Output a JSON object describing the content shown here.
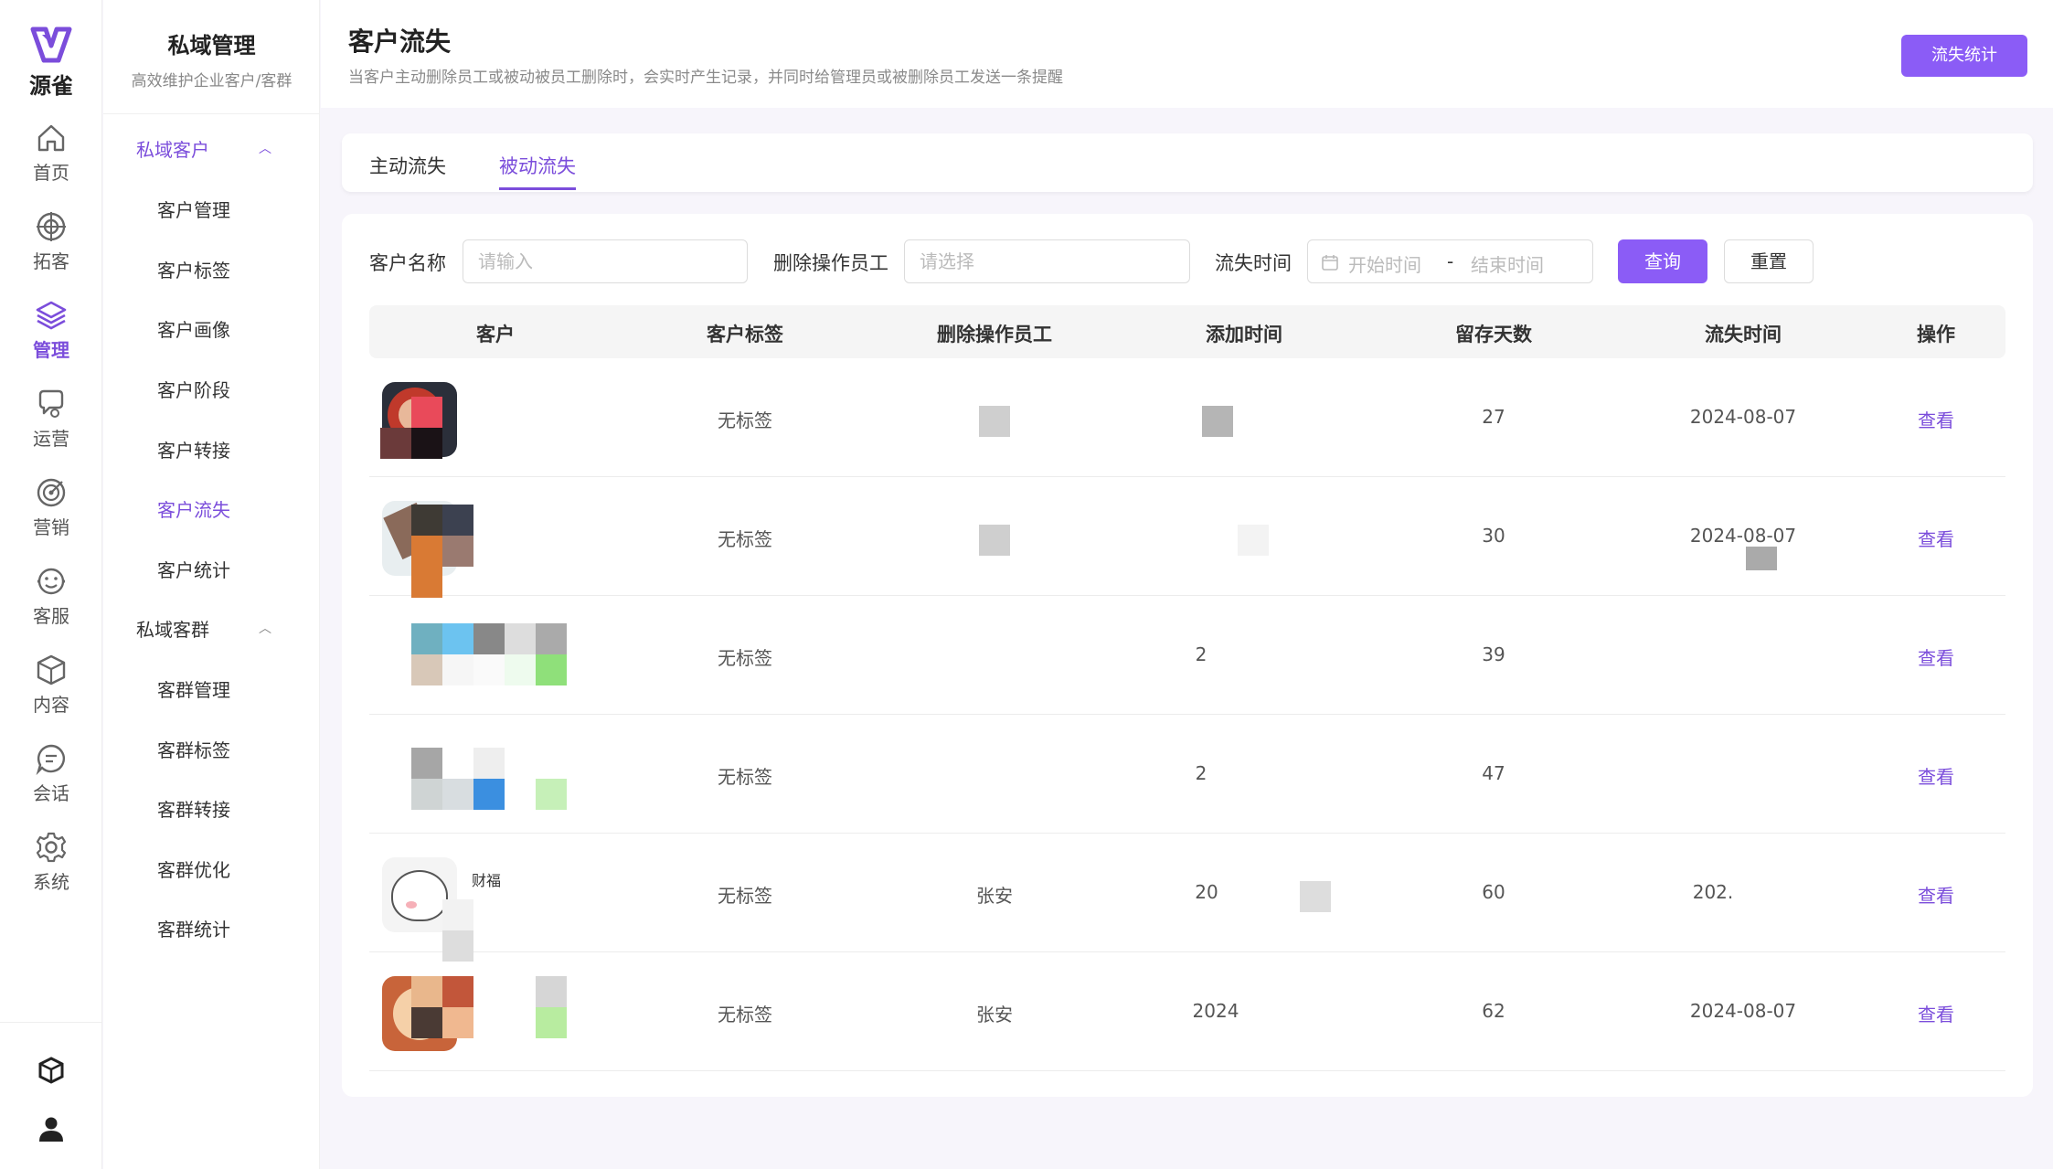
{
  "app": {
    "logo_text": "源雀",
    "brand_color": "#7b4ddb",
    "accent_button_color": "#8b5cf6"
  },
  "rail": [
    {
      "label": "首页",
      "icon": "home-icon"
    },
    {
      "label": "拓客",
      "icon": "target-icon"
    },
    {
      "label": "管理",
      "icon": "layers-icon",
      "active": true
    },
    {
      "label": "运营",
      "icon": "chat-bubbles-icon"
    },
    {
      "label": "营销",
      "icon": "dartboard-icon"
    },
    {
      "label": "客服",
      "icon": "smiley-icon"
    },
    {
      "label": "内容",
      "icon": "cube-icon"
    },
    {
      "label": "会话",
      "icon": "message-icon"
    },
    {
      "label": "系统",
      "icon": "gear-icon"
    }
  ],
  "rail_bottom": [
    {
      "icon": "cube-badge-icon"
    },
    {
      "icon": "user-icon"
    }
  ],
  "sidebar": {
    "title": "私域管理",
    "desc": "高效维护企业客户/客群",
    "groups": [
      {
        "label": "私域客户",
        "items": [
          "客户管理",
          "客户标签",
          "客户画像",
          "客户阶段",
          "客户转接",
          "客户流失",
          "客户统计"
        ]
      },
      {
        "label": "私域客群",
        "items": [
          "客群管理",
          "客群标签",
          "客群转接",
          "客群优化",
          "客群统计"
        ]
      }
    ],
    "active_item": "客户流失"
  },
  "header": {
    "title": "客户流失",
    "desc": "当客户主动删除员工或被动被员工删除时，会实时产生记录，并同时给管理员或被删除员工发送一条提醒",
    "stat_button": "流失统计"
  },
  "tabs": [
    {
      "label": "主动流失"
    },
    {
      "label": "被动流失",
      "active": true
    }
  ],
  "filters": {
    "customer_name_label": "客户名称",
    "customer_name_placeholder": "请输入",
    "operator_label": "删除操作员工",
    "operator_placeholder": "请选择",
    "time_label": "流失时间",
    "start_placeholder": "开始时间",
    "range_sep": "-",
    "end_placeholder": "结束时间",
    "query_button": "查询",
    "reset_button": "重置"
  },
  "table": {
    "columns": [
      "客户",
      "客户标签",
      "删除操作员工",
      "添加时间",
      "留存天数",
      "流失时间",
      "操作"
    ],
    "rows": [
      {
        "tag": "无标签",
        "operator": "",
        "added": "",
        "days": "27",
        "lost": "2024-08-07",
        "action": "查看"
      },
      {
        "tag": "无标签",
        "operator": "",
        "added": "",
        "days": "30",
        "lost": "2024-08-07",
        "action": "查看"
      },
      {
        "tag": "无标签",
        "operator": "",
        "added": "2",
        "days": "39",
        "lost": "",
        "action": "查看"
      },
      {
        "tag": "无标签",
        "operator": "",
        "added": "2",
        "days": "47",
        "lost": "",
        "action": "查看"
      },
      {
        "tag": "无标签",
        "operator": "张安",
        "added": "20",
        "days": "60",
        "lost": "202.",
        "action": "查看",
        "name_fragment": "财福"
      },
      {
        "tag": "无标签",
        "operator": "张安",
        "added": "2024",
        "days": "62",
        "lost": "2024-08-07",
        "action": "查看"
      }
    ]
  }
}
